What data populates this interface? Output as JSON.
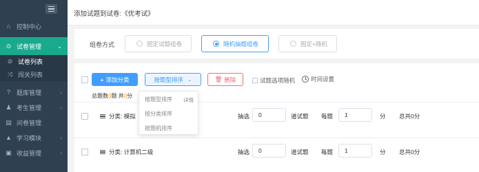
{
  "sidebar": {
    "items": [
      {
        "label": "控制中心",
        "icon": "home-icon"
      },
      {
        "label": "试卷管理",
        "icon": "check-circle-icon",
        "active": true
      },
      {
        "label": "题库管理",
        "icon": "question-circle-icon"
      },
      {
        "label": "考生管理",
        "icon": "user-icon"
      },
      {
        "label": "问卷管理",
        "icon": "document-icon"
      },
      {
        "label": "学习模块",
        "icon": "graduation-cap-icon"
      },
      {
        "label": "收益管理",
        "icon": "money-icon"
      }
    ],
    "subitems": [
      {
        "label": "试卷列表"
      },
      {
        "label": "闯关列表"
      }
    ]
  },
  "header": {
    "title": "添加试题到试卷:《优考试》"
  },
  "mode": {
    "label": "组卷方式",
    "options": [
      "固定试题组卷",
      "随机抽题组卷",
      "固定+随机"
    ],
    "selected": "随机抽题组卷"
  },
  "toolbar": {
    "add_label": "添加分类",
    "sort_label": "按题型排序",
    "delete_label": "删除",
    "shuffle_label": "试题选项随机",
    "time_label": "时间设置"
  },
  "summary": {
    "prefix": "总题数",
    "count": "0",
    "mid": "题 共",
    "score": "0",
    "suffix": "分"
  },
  "dropdown": {
    "items": [
      "按题型排序",
      "按分类排序",
      "按题机排序"
    ],
    "detail": "详情"
  },
  "rows": [
    {
      "title": "分类: 模拟"
    },
    {
      "title": "分类: 计算机二级"
    }
  ],
  "row_labels": {
    "pick": "抽选",
    "unit_questions": "道试题",
    "each": "每题",
    "unit_points": "分",
    "total": "总共0分",
    "pick_value": "0",
    "each_value": "1"
  },
  "colors": {
    "sidebar_bg": "#2f4050",
    "active_green": "#19aa8d",
    "primary_blue": "#409eff",
    "danger_red": "#f56c6c",
    "highlight_orange": "#ff9900"
  }
}
